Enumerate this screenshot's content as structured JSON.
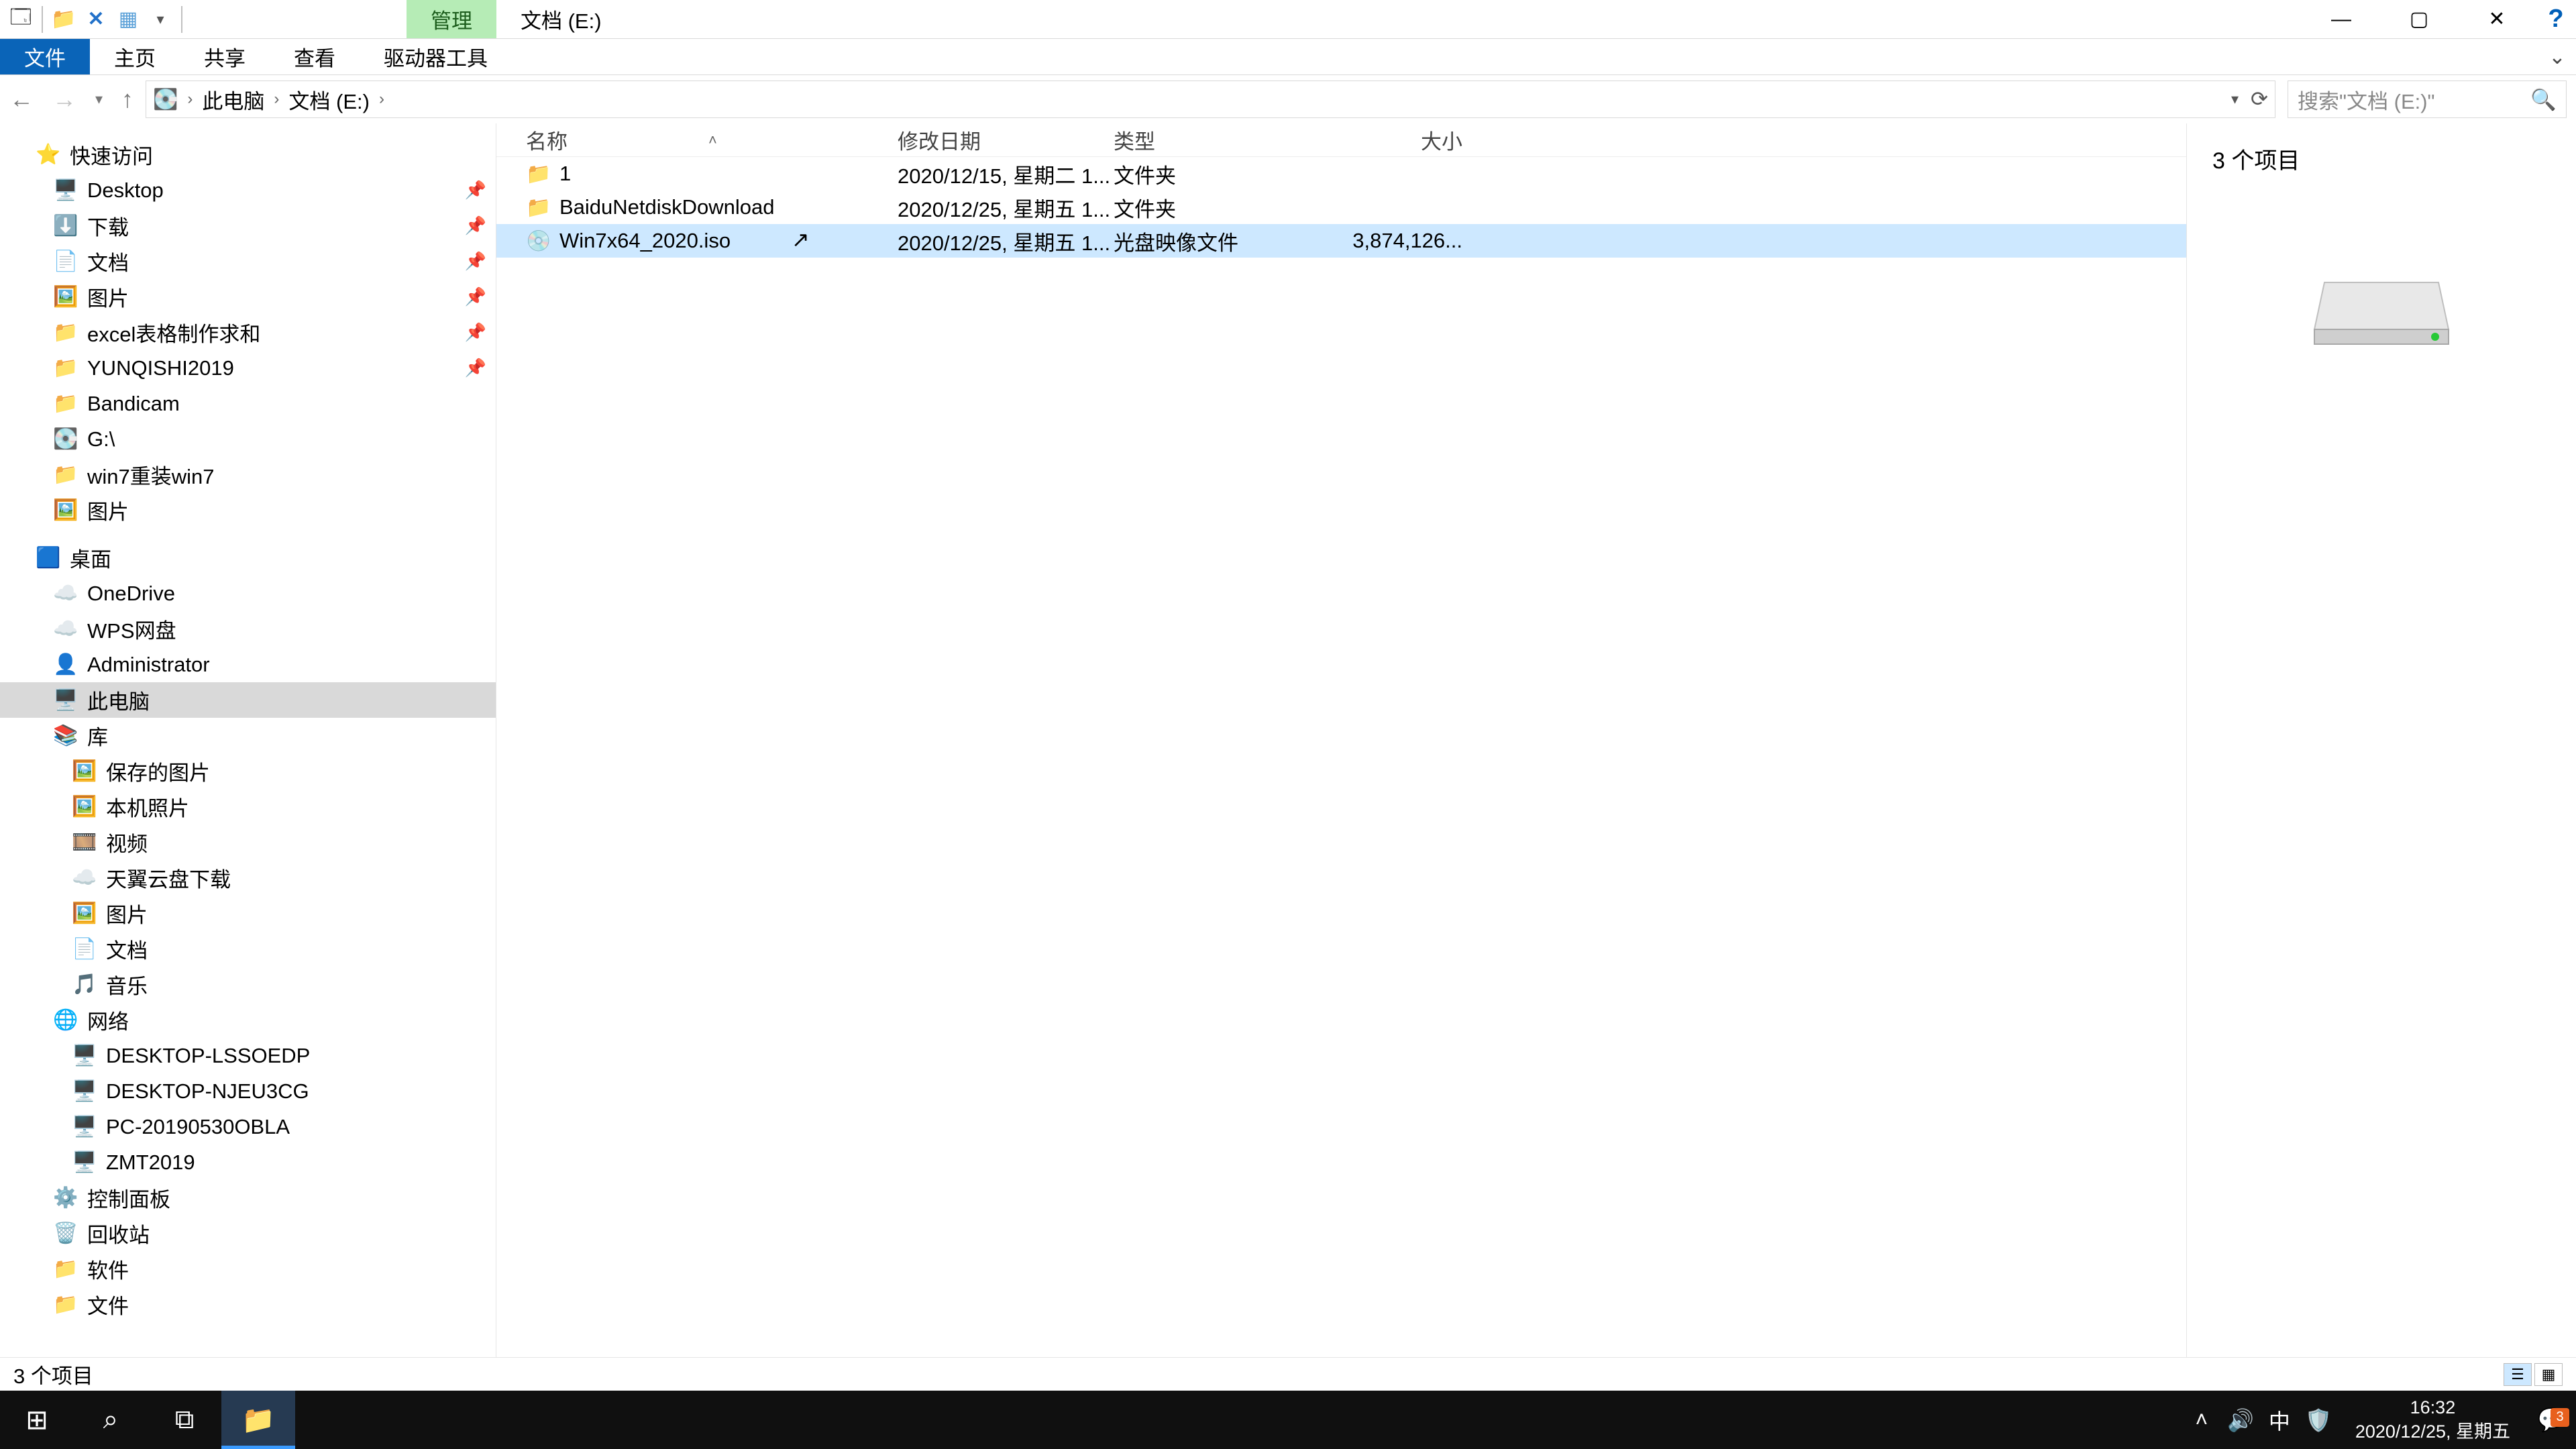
{
  "titlebar": {
    "contextual_tab": "管理",
    "title": "文档 (E:)",
    "min": "—",
    "max": "▢",
    "close": "✕",
    "help": "?"
  },
  "ribbon": {
    "file": "文件",
    "home": "主页",
    "share": "共享",
    "view": "查看",
    "drive": "驱动器工具"
  },
  "breadcrumb": {
    "root": "此电脑",
    "drive": "文档 (E:)",
    "search_placeholder": "搜索\"文档 (E:)\""
  },
  "columns": {
    "name": "名称",
    "date": "修改日期",
    "type": "类型",
    "size": "大小"
  },
  "rows": [
    {
      "icon": "📁",
      "name": "1",
      "date": "2020/12/15, 星期二 1...",
      "type": "文件夹",
      "size": ""
    },
    {
      "icon": "📁",
      "name": "BaiduNetdiskDownload",
      "date": "2020/12/25, 星期五 1...",
      "type": "文件夹",
      "size": ""
    },
    {
      "icon": "💿",
      "name": "Win7x64_2020.iso",
      "date": "2020/12/25, 星期五 1...",
      "type": "光盘映像文件",
      "size": "3,874,126..."
    }
  ],
  "tree": {
    "quick_access": "快速访问",
    "q": [
      {
        "icon": "🖥️",
        "label": "Desktop",
        "pin": true
      },
      {
        "icon": "⬇️",
        "label": "下载",
        "pin": true
      },
      {
        "icon": "📄",
        "label": "文档",
        "pin": true
      },
      {
        "icon": "🖼️",
        "label": "图片",
        "pin": true
      },
      {
        "icon": "📁",
        "label": "excel表格制作求和",
        "pin": true
      },
      {
        "icon": "📁",
        "label": "YUNQISHI2019",
        "pin": true
      },
      {
        "icon": "📁",
        "label": "Bandicam",
        "pin": false
      },
      {
        "icon": "💽",
        "label": "G:\\",
        "pin": false
      },
      {
        "icon": "📁",
        "label": "win7重装win7",
        "pin": false
      },
      {
        "icon": "🖼️",
        "label": "图片",
        "pin": false
      }
    ],
    "desktop": "桌面",
    "d": [
      {
        "icon": "☁️",
        "label": "OneDrive"
      },
      {
        "icon": "☁️",
        "label": "WPS网盘"
      },
      {
        "icon": "👤",
        "label": "Administrator"
      },
      {
        "icon": "🖥️",
        "label": "此电脑",
        "selected": true
      },
      {
        "icon": "📚",
        "label": "库"
      }
    ],
    "lib": [
      {
        "icon": "🖼️",
        "label": "保存的图片"
      },
      {
        "icon": "🖼️",
        "label": "本机照片"
      },
      {
        "icon": "🎞️",
        "label": "视频"
      },
      {
        "icon": "☁️",
        "label": "天翼云盘下载"
      },
      {
        "icon": "🖼️",
        "label": "图片"
      },
      {
        "icon": "📄",
        "label": "文档"
      },
      {
        "icon": "🎵",
        "label": "音乐"
      }
    ],
    "network": "网络",
    "n": [
      {
        "icon": "🖥️",
        "label": "DESKTOP-LSSOEDP"
      },
      {
        "icon": "🖥️",
        "label": "DESKTOP-NJEU3CG"
      },
      {
        "icon": "🖥️",
        "label": "PC-20190530OBLA"
      },
      {
        "icon": "🖥️",
        "label": "ZMT2019"
      }
    ],
    "extra": [
      {
        "icon": "⚙️",
        "label": "控制面板"
      },
      {
        "icon": "🗑️",
        "label": "回收站"
      },
      {
        "icon": "📁",
        "label": "软件"
      },
      {
        "icon": "📁",
        "label": "文件"
      }
    ]
  },
  "preview": {
    "count": "3 个项目"
  },
  "status": {
    "text": "3 个项目"
  },
  "taskbar": {
    "time": "16:32",
    "date": "2020/12/25, 星期五",
    "ime": "中",
    "notif_count": "3"
  }
}
